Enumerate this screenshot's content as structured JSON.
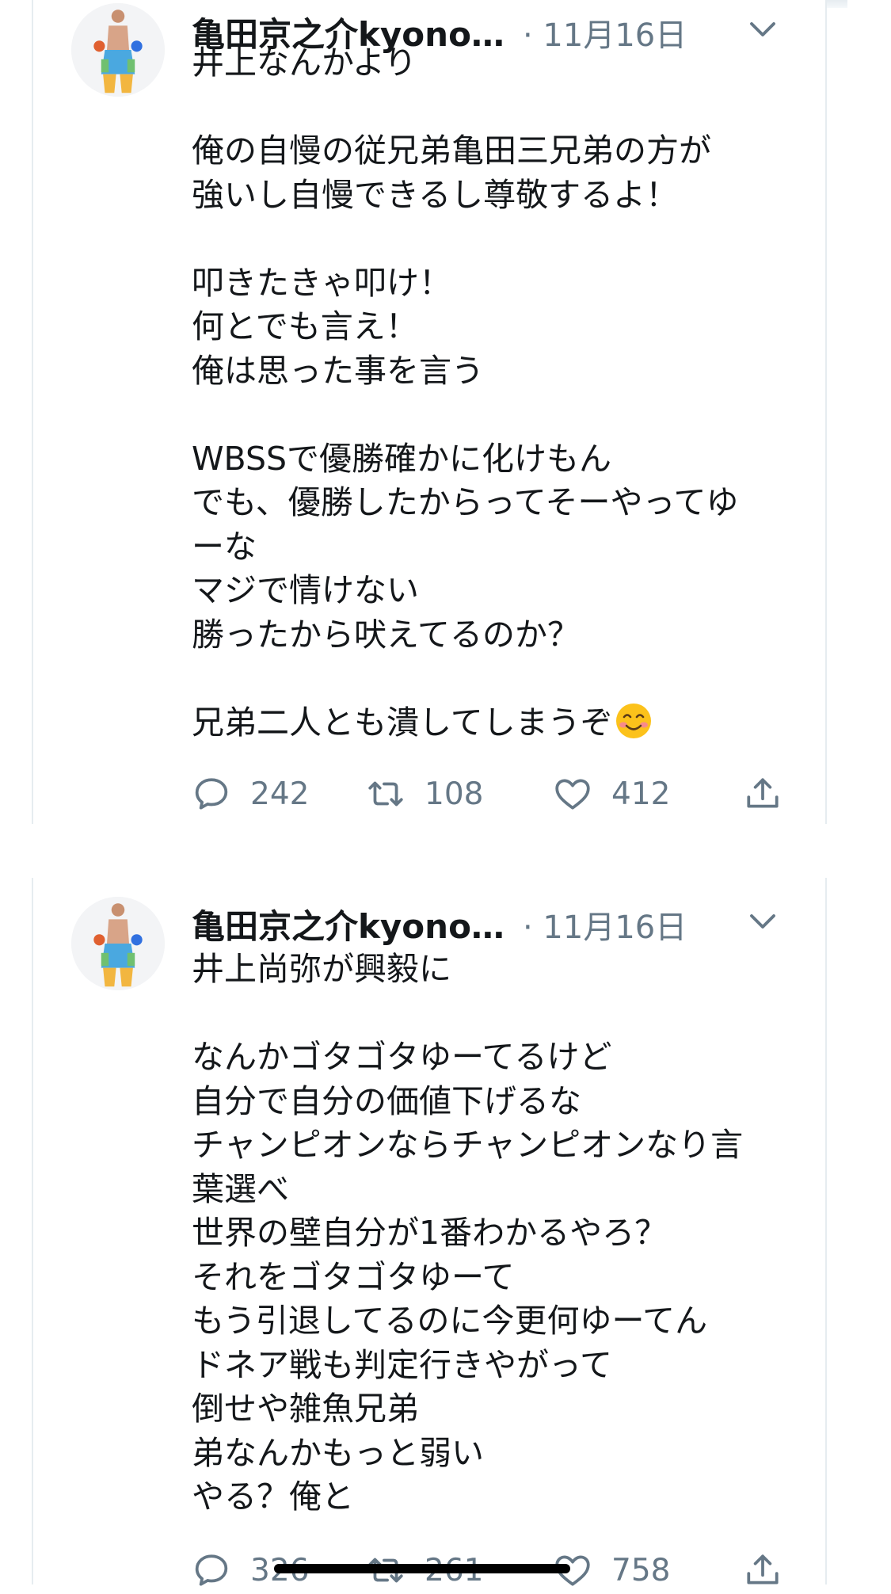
{
  "tweets": [
    {
      "display_name": "亀田京之介kyono…",
      "date": "· 11月16日",
      "text": "井上なんかより\n\n俺の自慢の従兄弟亀田三兄弟の方が\n強いし自慢できるし尊敬するよ！\n\n叩きたきゃ叩け！\n何とでも言え！\n俺は思った事を言う\n\nWBSSで優勝確かに化けもん\nでも、優勝したからってそーやってゆ\nーな\nマジで情けない\n勝ったから吠えてるのか？\n\n兄弟二人とも潰してしまうぞ",
      "emoji": "smiling-face-icon",
      "replies": "242",
      "retweets": "108",
      "likes": "412"
    },
    {
      "display_name": "亀田京之介kyono…",
      "date": "· 11月16日",
      "text": "井上尚弥が興毅に\n\nなんかゴタゴタゆーてるけど\n自分で自分の価値下げるな\nチャンピオンならチャンピオンなり言\n葉選べ\n世界の壁自分が1番わかるやろ？\nそれをゴタゴタゆーて\nもう引退してるのに今更何ゆーてん\nドネア戦も判定行きやがって\n倒せや雑魚兄弟\n弟なんかもっと弱い\nやる？俺と",
      "replies": "326",
      "retweets": "261",
      "likes": "758"
    }
  ],
  "colors": {
    "text": "#14171a",
    "secondary": "#657786",
    "divider": "#e6ecf0",
    "background": "#ffffff"
  }
}
